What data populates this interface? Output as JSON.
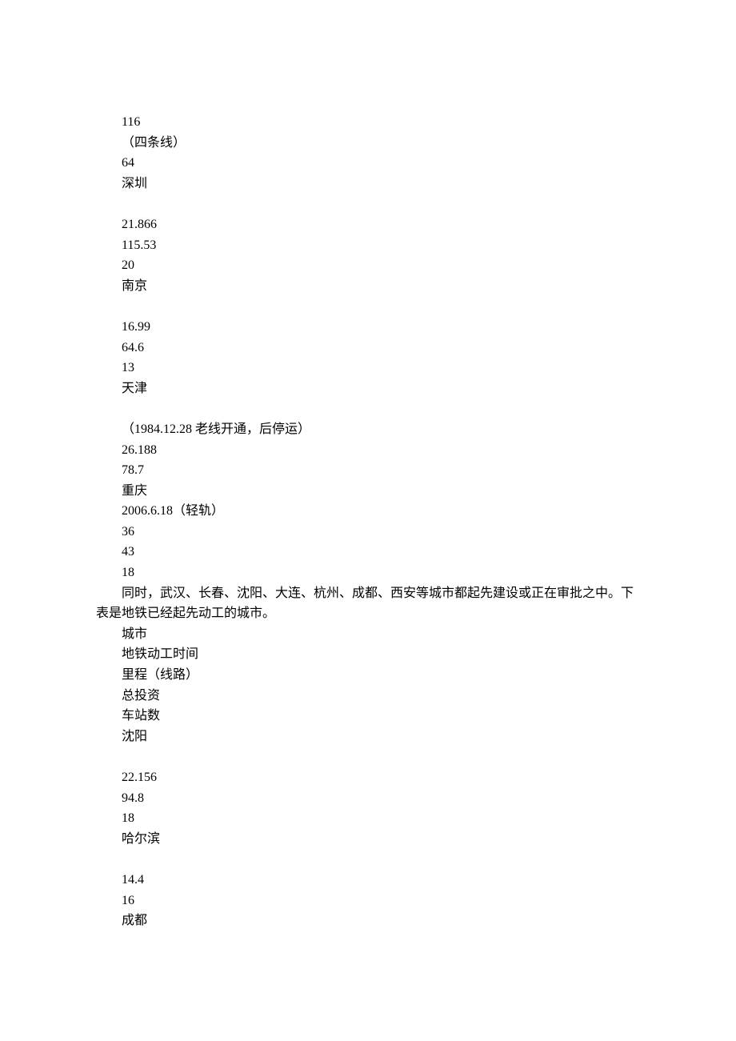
{
  "lines": {
    "l1": "116",
    "l2": "（四条线）",
    "l3": "64",
    "l4": "深圳",
    "l5": "21.866",
    "l6": "115.53",
    "l7": "20",
    "l8": "南京",
    "l9": "16.99",
    "l10": "64.6",
    "l11": "13",
    "l12": "天津",
    "l13": "（1984.12.28 老线开通，后停运）",
    "l14": "26.188",
    "l15": "78.7",
    "l16": "重庆",
    "l17": "2006.6.18（轻轨）",
    "l18": "36",
    "l19": "43",
    "l20": "18",
    "l22": "城市",
    "l23": "地铁动工时间",
    "l24": "里程（线路）",
    "l25": "总投资",
    "l26": "车站数",
    "l27": "沈阳",
    "l28": "22.156",
    "l29": "94.8",
    "l30": "18",
    "l31": "哈尔滨",
    "l32": "14.4",
    "l33": "16",
    "l34": "成都"
  },
  "para": {
    "p1": "同时，武汉、长春、沈阳、大连、杭州、成都、西安等城市都起先建设或正在审批之中。下表是地铁已经起先动工的城市。"
  }
}
